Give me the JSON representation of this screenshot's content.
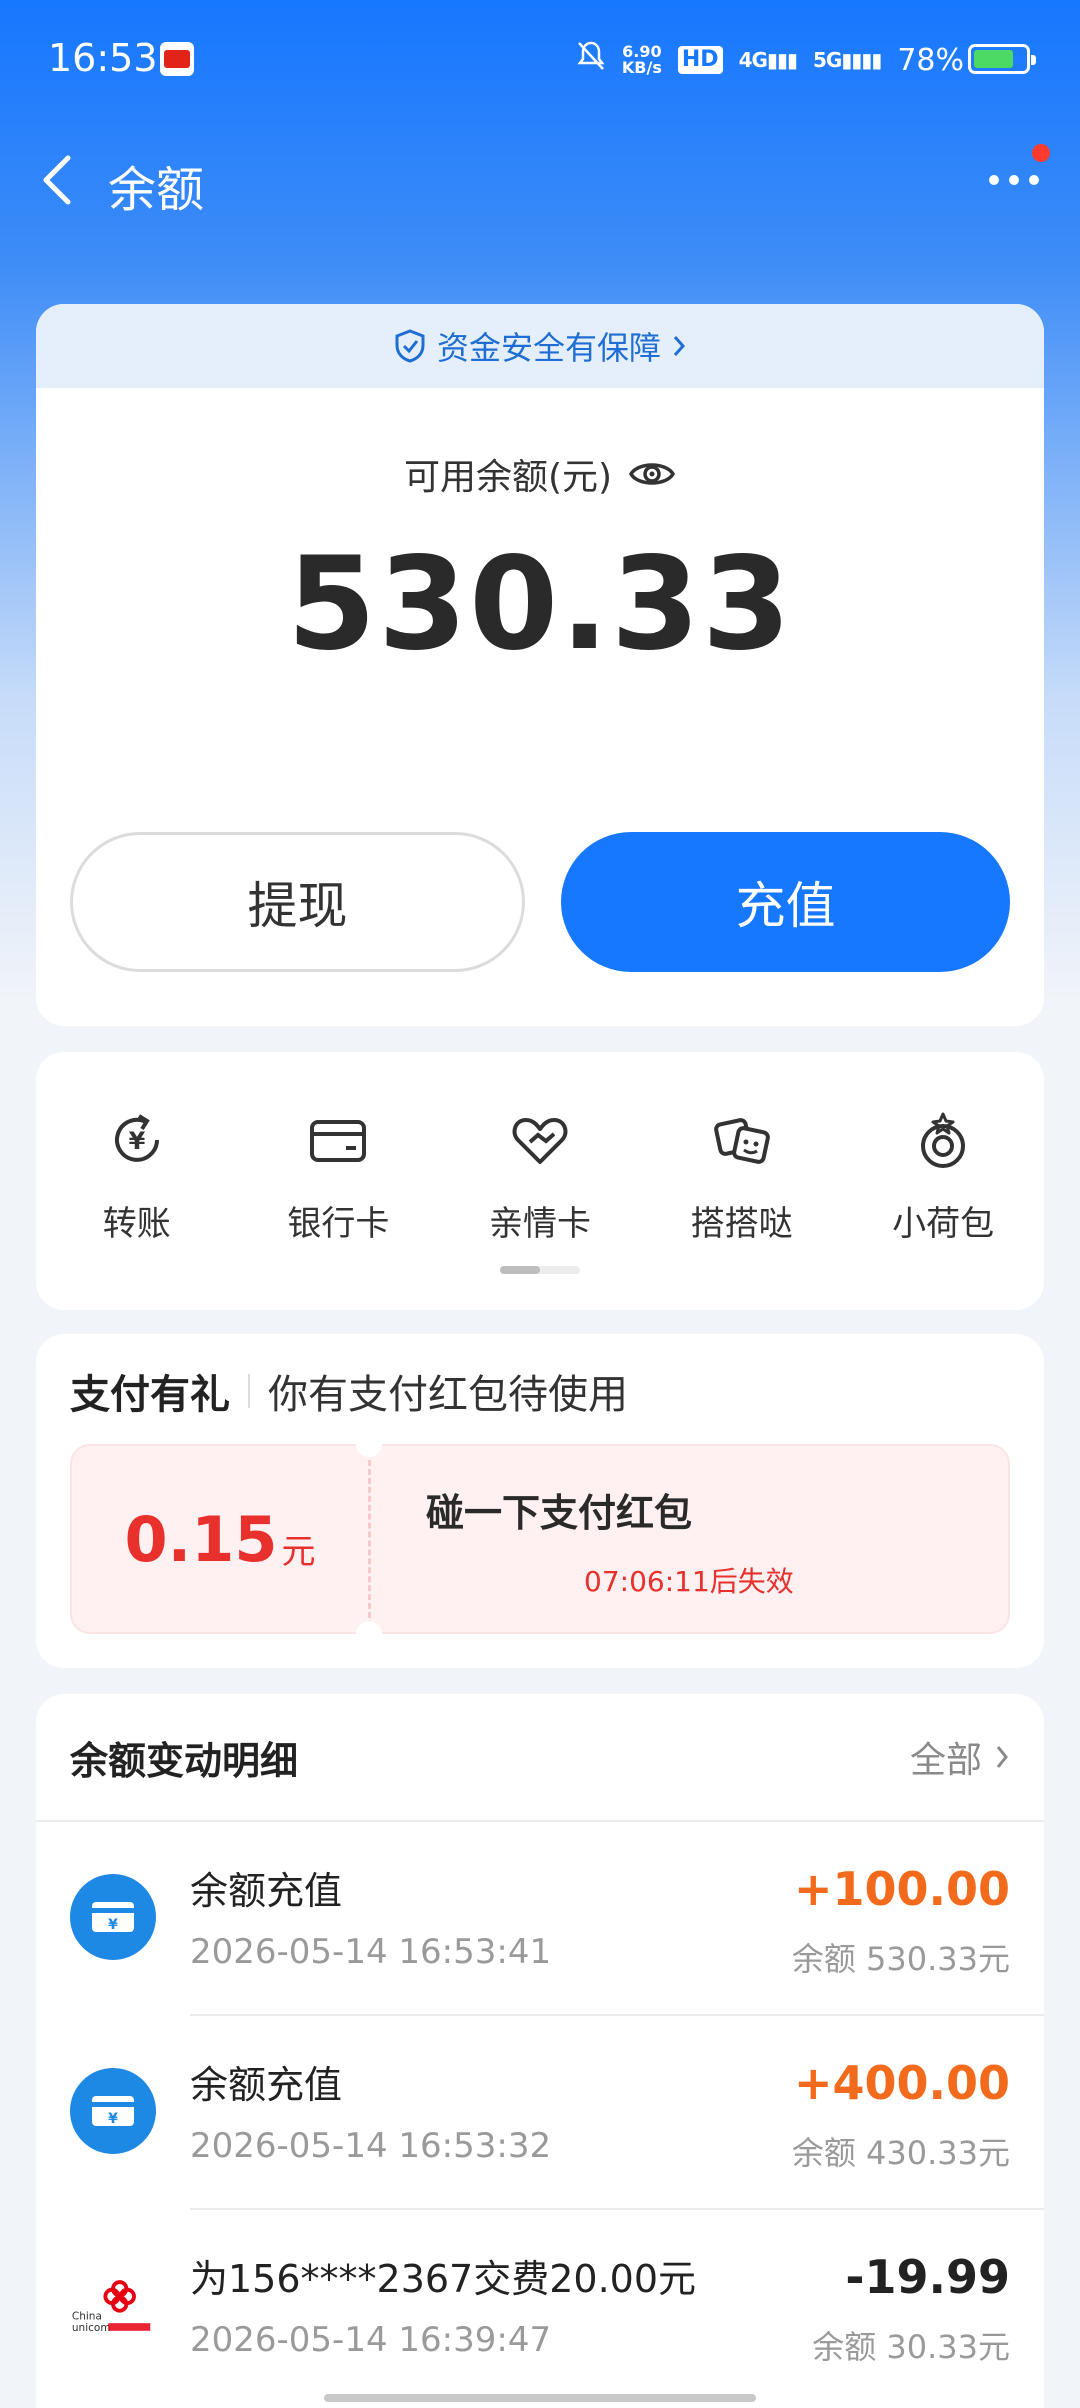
{
  "status_bar": {
    "time": "16:53",
    "net_speed_value": "6.90",
    "net_speed_unit": "KB/s",
    "hd": "HD",
    "sig1": "4G",
    "sig2": "5G",
    "battery": "78%",
    "battery_level": 0.78
  },
  "nav": {
    "title": "余额"
  },
  "balance": {
    "safety_text": "资金安全有保障",
    "label": "可用余额(元)",
    "amount": "530.33",
    "withdraw_label": "提现",
    "recharge_label": "充值"
  },
  "quick": {
    "items": [
      {
        "label": "转账",
        "icon": "transfer-icon"
      },
      {
        "label": "银行卡",
        "icon": "bank-card-icon"
      },
      {
        "label": "亲情卡",
        "icon": "family-card-icon"
      },
      {
        "label": "搭搭哒",
        "icon": "dadada-icon"
      },
      {
        "label": "小荷包",
        "icon": "purse-icon"
      }
    ]
  },
  "gift": {
    "title": "支付有礼",
    "subtitle": "你有支付红包待使用",
    "coupon_amount": "0.15",
    "coupon_unit": "元",
    "coupon_name": "碰一下支付红包",
    "coupon_expire": "07:06:11后失效"
  },
  "details": {
    "title": "余额变动明细",
    "all_label": "全部",
    "rows": [
      {
        "name": "余额充值",
        "time": "2026-05-14 16:53:41",
        "amount": "+100.00",
        "balance": "余额 530.33元",
        "icon": "recharge-card-icon"
      },
      {
        "name": "余额充值",
        "time": "2026-05-14 16:53:32",
        "amount": "+400.00",
        "balance": "余额 430.33元",
        "icon": "recharge-card-icon"
      },
      {
        "name": "为156****2367交费20.00元",
        "time": "2026-05-14 16:39:47",
        "amount": "-19.99",
        "balance": "余额 30.33元",
        "icon": "china-unicom-logo-icon"
      }
    ]
  },
  "colors": {
    "accent": "#1677ff",
    "positive": "#f26a1b",
    "coupon_red": "#e8302c"
  }
}
